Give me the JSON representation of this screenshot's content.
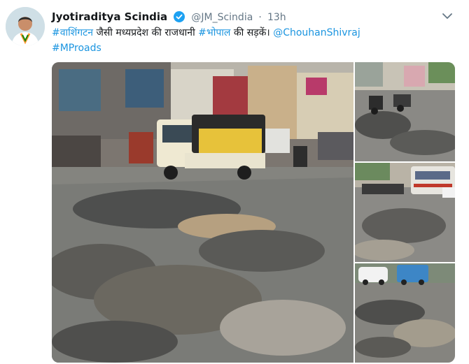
{
  "tweet": {
    "display_name": "Jyotiraditya Scindia",
    "handle": "@JM_Scindia",
    "separator": "·",
    "timestamp": "13h",
    "text": {
      "hashtag1": "#वाशिंगटन",
      "middle": " जैसी मध्यप्रदेश की राजधानी ",
      "hashtag2": "#भोपाल",
      "after": " की सड़कें। ",
      "mention": "@ChouhanShivraj",
      "hashtag3": "#MProads"
    }
  },
  "icons": {
    "verified": "verified-badge-icon",
    "menu": "chevron-down-icon"
  },
  "colors": {
    "link": "#1b95e0",
    "name": "#14171a",
    "meta": "#657786",
    "verified": "#1da1f2"
  }
}
